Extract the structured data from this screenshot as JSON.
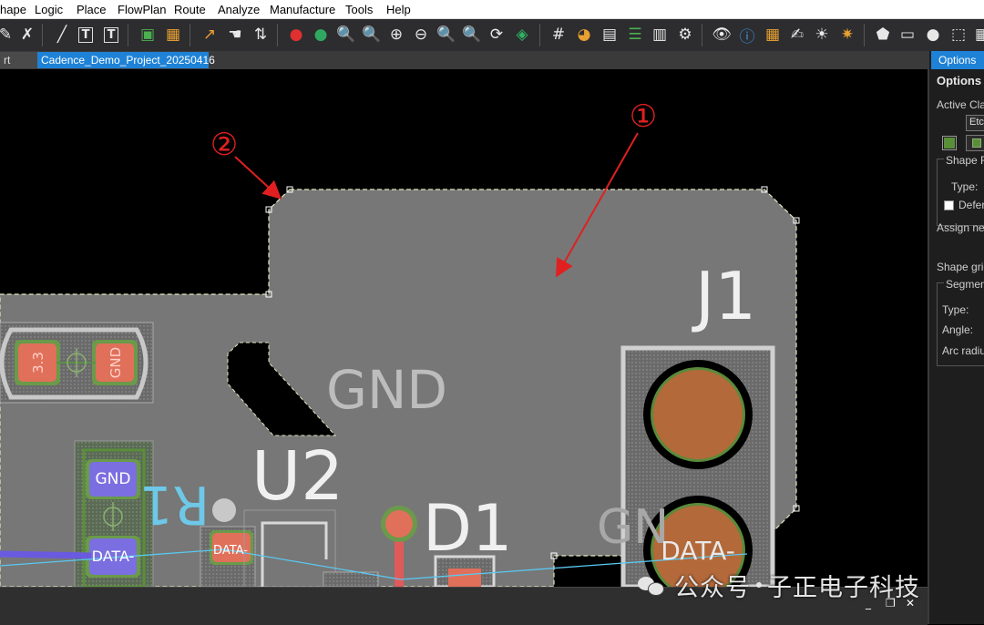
{
  "menu": {
    "items": [
      "hape",
      "Logic",
      "Place",
      "FlowPlan",
      "Route",
      "Analyze",
      "Manufacture",
      "Tools",
      "Help"
    ]
  },
  "tabs": {
    "start": "rt Page",
    "project": "Cadence_Demo_Project_20250416"
  },
  "panel": {
    "tab": "Options",
    "heading": "Options",
    "active_class": "Active Clas",
    "etch": "Etch",
    "shape_fill": "Shape Fi",
    "type": "Type:",
    "defer": "Defer",
    "assign_net": "Assign net",
    "shape_grid": "Shape grid",
    "segment": "Segment",
    "seg_type": "Type:",
    "angle": "Angle:",
    "arc_radius": "Arc radiu",
    "swatch_color": "#5a8f3a"
  },
  "pcb": {
    "silk": {
      "j1": "J1",
      "gnd": "GND",
      "u2": "U2",
      "d1": "D1",
      "r1": "R1",
      "gn": "GN"
    },
    "pads": {
      "v33": "3.3",
      "gnd_small": "GND",
      "gnd_pad": "GND",
      "data_pad": "DATA-",
      "data_r1": "DATA-",
      "data_j1": "DATA-"
    },
    "callouts": {
      "one": "①",
      "two": "②"
    },
    "colors": {
      "shape": "#777777",
      "copper": "#b4693a",
      "silk": "#d8d8d8",
      "callout": "#e02020"
    }
  },
  "watermark": {
    "text1": "公众号",
    "text2": "子正电子科技"
  }
}
